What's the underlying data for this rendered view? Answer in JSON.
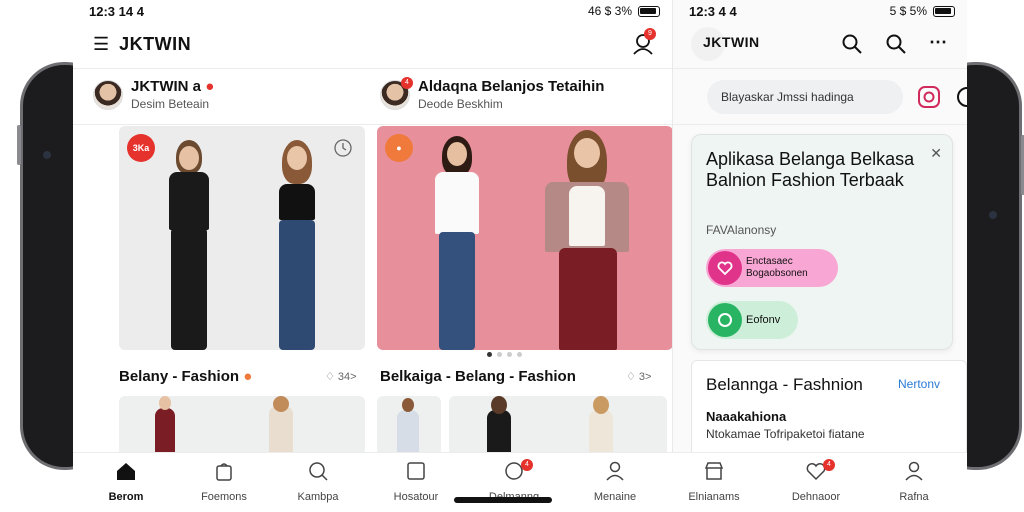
{
  "status_bar": {
    "time_main": "12:3 14 4",
    "signal_main": "46 $ 3%",
    "time_side": "12:3 4 4",
    "signal_side": "5 $ 5%"
  },
  "header": {
    "brand": "JKTWIN",
    "side_brand": "JKTWIN",
    "notification_count": "9"
  },
  "stories": [
    {
      "name": "JKTWIN a",
      "subtitle": "Desim Beteain"
    },
    {
      "name": "Aldaqna Belanjos Tetaihin",
      "subtitle": "Deode Beskhim",
      "badge": "4"
    }
  ],
  "cards": [
    {
      "title": "Belany - Fashion",
      "meta": "♢ 34>",
      "tag": "3Ka",
      "tag_color": "#e5322d"
    },
    {
      "title": "Belkaiga - Belang - Fashion",
      "meta": "♢ 3>",
      "tag": "",
      "tag_color": "#f07a3b"
    }
  ],
  "carousel": {
    "count": 4,
    "active": 0
  },
  "tabs": [
    {
      "label": "Berom",
      "icon": "home-icon",
      "active": true
    },
    {
      "label": "Foemons",
      "icon": "bag-icon",
      "active": false
    },
    {
      "label": "Kambpa",
      "icon": "search-icon",
      "active": false
    },
    {
      "label": "Hosatour",
      "icon": "box-icon",
      "active": false
    },
    {
      "label": "Delmanng",
      "icon": "globe-icon",
      "active": false,
      "badge": "4"
    },
    {
      "label": "Menaine",
      "icon": "user-icon",
      "active": false
    },
    {
      "label": "Elnianams",
      "icon": "store-icon",
      "active": false
    },
    {
      "label": "Dehnaoor",
      "icon": "heart-icon",
      "active": false,
      "badge": "4"
    },
    {
      "label": "Rafna",
      "icon": "profile-icon",
      "active": false
    }
  ],
  "side": {
    "search_text": "Blayaskar Jmssi hadinga",
    "promo_title": "Aplikasa Belanga Belkasa Balnion Fashion Terbaak",
    "promo_subtitle": "FAVAlanonsy",
    "primary_button": {
      "line1": "Enctasaec",
      "line2": "Bogaobsonen",
      "color": "#f8a6d4"
    },
    "secondary_button": {
      "label": "Eofonv",
      "color": "#cdeed8"
    },
    "card2_title": "Belannga - Fashnion",
    "card2_link": "Nertonv",
    "card2_heading": "Naaakahiona",
    "card2_text": "Ntokamae Tofripaketoi fiatane"
  },
  "colors": {
    "accent": "#e5322d",
    "brand_pink": "#e0348a",
    "brand_green": "#28b463",
    "card_pink": "#e78f9a"
  }
}
